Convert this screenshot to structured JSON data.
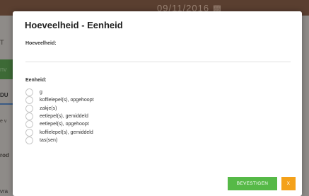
{
  "background": {
    "header_date": "09/11/2016",
    "left_fragments": [
      "T",
      "nv",
      "DU",
      "e v",
      "rod"
    ],
    "bottom_fragment": "vra"
  },
  "modal": {
    "title": "Hoeveelheid - Eenheid",
    "quantity_label": "Hoeveelheid:",
    "quantity_value": "",
    "unit_label": "Eenheid:",
    "unit_options": [
      {
        "label": "g",
        "selected": false
      },
      {
        "label": "koffielepel(s), opgehoopt",
        "selected": false
      },
      {
        "label": "zakje(s)",
        "selected": false
      },
      {
        "label": "eetlepel(s), gemiddeld",
        "selected": false
      },
      {
        "label": "eetlepel(s), opgehoopt",
        "selected": false
      },
      {
        "label": "koffielepel(s), gemiddeld",
        "selected": false
      },
      {
        "label": "tas(sen)",
        "selected": false
      }
    ],
    "confirm_label": "BEVESTIGEN",
    "close_label": "X"
  },
  "colors": {
    "confirm": "#56b947",
    "close": "#f4a11a"
  },
  "icons": {
    "calendar": "calendar-icon"
  }
}
